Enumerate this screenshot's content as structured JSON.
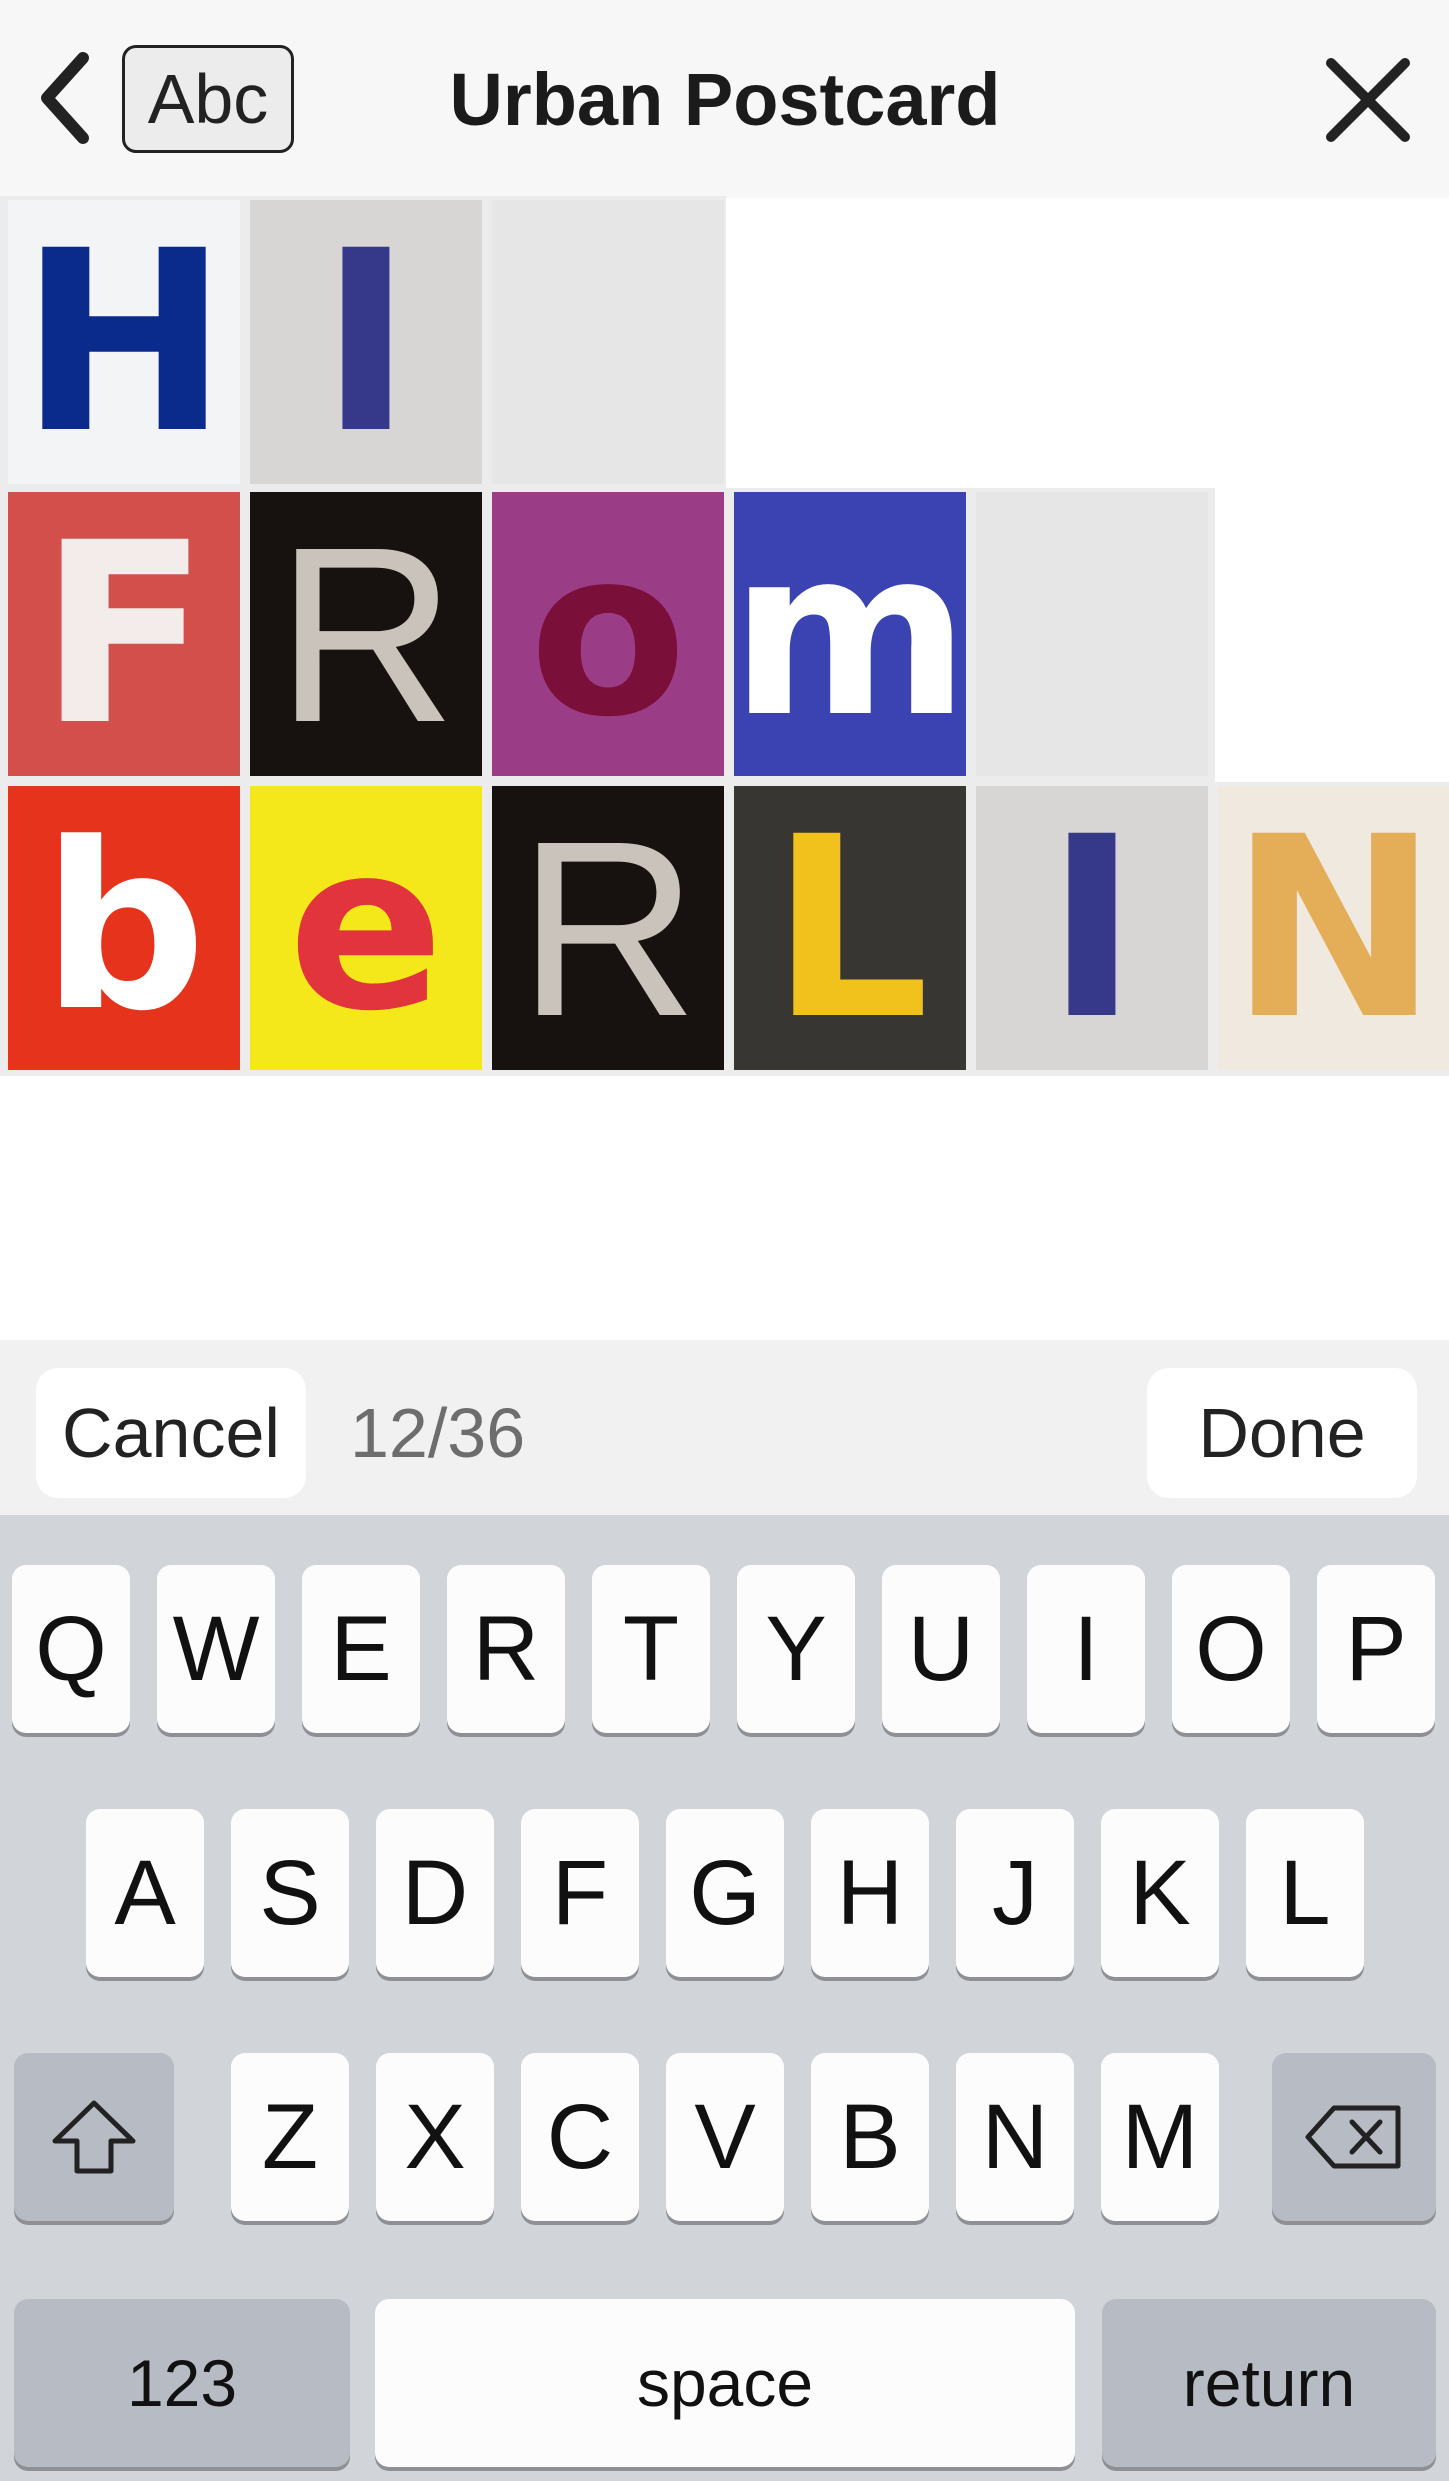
{
  "header": {
    "back_icon": "chevron-left-icon",
    "style_button_label": "Abc",
    "title": "Urban Postcard",
    "close_icon": "close-icon"
  },
  "tiles": {
    "row1": [
      {
        "letter": "H",
        "bg": "#f3f4f6",
        "fg": "#0a2a8c"
      },
      {
        "letter": "I",
        "bg": "#d8d6d4",
        "fg": "#363889"
      },
      {
        "letter": "",
        "bg": "",
        "fg": ""
      }
    ],
    "row2": [
      {
        "letter": "F",
        "bg": "#d24f4c",
        "fg": "#f3ecea"
      },
      {
        "letter": "R",
        "bg": "#17120f",
        "fg": "#c9c3bb"
      },
      {
        "letter": "o",
        "bg": "#9b3d86",
        "fg": "#7a0f3a"
      },
      {
        "letter": "m",
        "bg": "#3b43b3",
        "fg": "#ffffff"
      },
      {
        "letter": "",
        "bg": "",
        "fg": ""
      }
    ],
    "row3": [
      {
        "letter": "b",
        "bg": "#e5331c",
        "fg": "#ffffff"
      },
      {
        "letter": "e",
        "bg": "#f5e81a",
        "fg": "#e2343c"
      },
      {
        "letter": "R",
        "bg": "#17120f",
        "fg": "#c9c3bb"
      },
      {
        "letter": "L",
        "bg": "#373633",
        "fg": "#f1c21b"
      },
      {
        "letter": "I",
        "bg": "#d8d6d4",
        "fg": "#363889"
      },
      {
        "letter": "N",
        "bg": "#efe9df",
        "fg": "#e4ad58"
      }
    ]
  },
  "input_bar": {
    "cancel_label": "Cancel",
    "counter": "12/36",
    "done_label": "Done"
  },
  "keyboard": {
    "row1": [
      "Q",
      "W",
      "E",
      "R",
      "T",
      "Y",
      "U",
      "I",
      "O",
      "P"
    ],
    "row2": [
      "A",
      "S",
      "D",
      "F",
      "G",
      "H",
      "J",
      "K",
      "L"
    ],
    "row3": [
      "Z",
      "X",
      "C",
      "V",
      "B",
      "N",
      "M"
    ],
    "shift_icon": "shift-icon",
    "backspace_icon": "backspace-icon",
    "numbers_label": "123",
    "space_label": "space",
    "return_label": "return"
  }
}
